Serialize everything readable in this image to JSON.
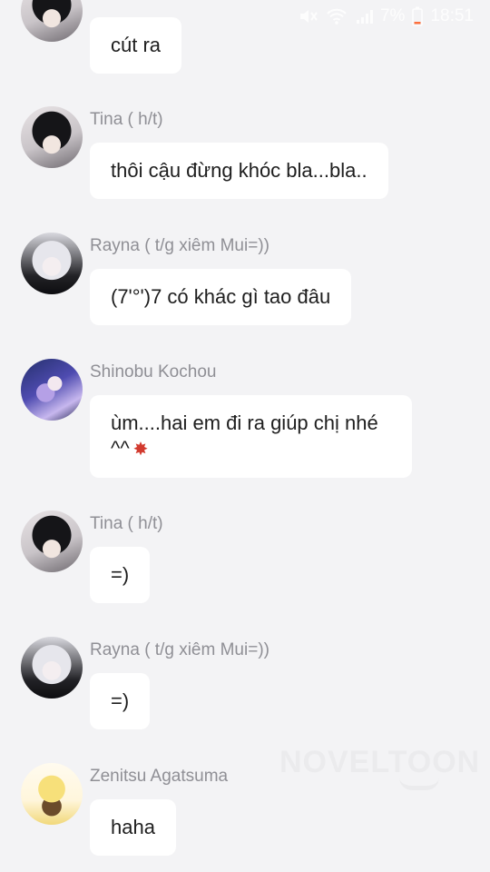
{
  "status_bar": {
    "battery": "7%",
    "time": "18:51",
    "icons": [
      "mute-icon",
      "wifi-icon",
      "signal-icon",
      "battery-icon"
    ]
  },
  "messages": [
    {
      "sender": "",
      "text": "cút ra",
      "avatar": "dark-hair-avatar"
    },
    {
      "sender": "Tina ( h/t)",
      "text": "thôi cậu đừng khóc bla...bla..",
      "avatar": "dark-hair-avatar"
    },
    {
      "sender": "Rayna ( t/g xiêm Mui=))",
      "text": "(7'°')7 có khác gì tao đâu",
      "avatar": "white-hair-avatar"
    },
    {
      "sender": "Shinobu Kochou",
      "text": "ùm....hai em đi ra giúp chị nhé ^^",
      "avatar": "shinobu-avatar",
      "emoji": "anger-icon"
    },
    {
      "sender": "Tina ( h/t)",
      "text": "=)",
      "avatar": "dark-hair-avatar"
    },
    {
      "sender": "Rayna ( t/g xiêm Mui=))",
      "text": "=)",
      "avatar": "white-hair-avatar"
    },
    {
      "sender": "Zenitsu Agatsuma",
      "text": "haha",
      "avatar": "zenitsu-avatar"
    }
  ],
  "watermark": "NOVELTOON",
  "colors": {
    "background": "#f3f3f5",
    "bubble": "#ffffff",
    "sender_text": "#8f8f95",
    "message_text": "#1e1e1e"
  }
}
